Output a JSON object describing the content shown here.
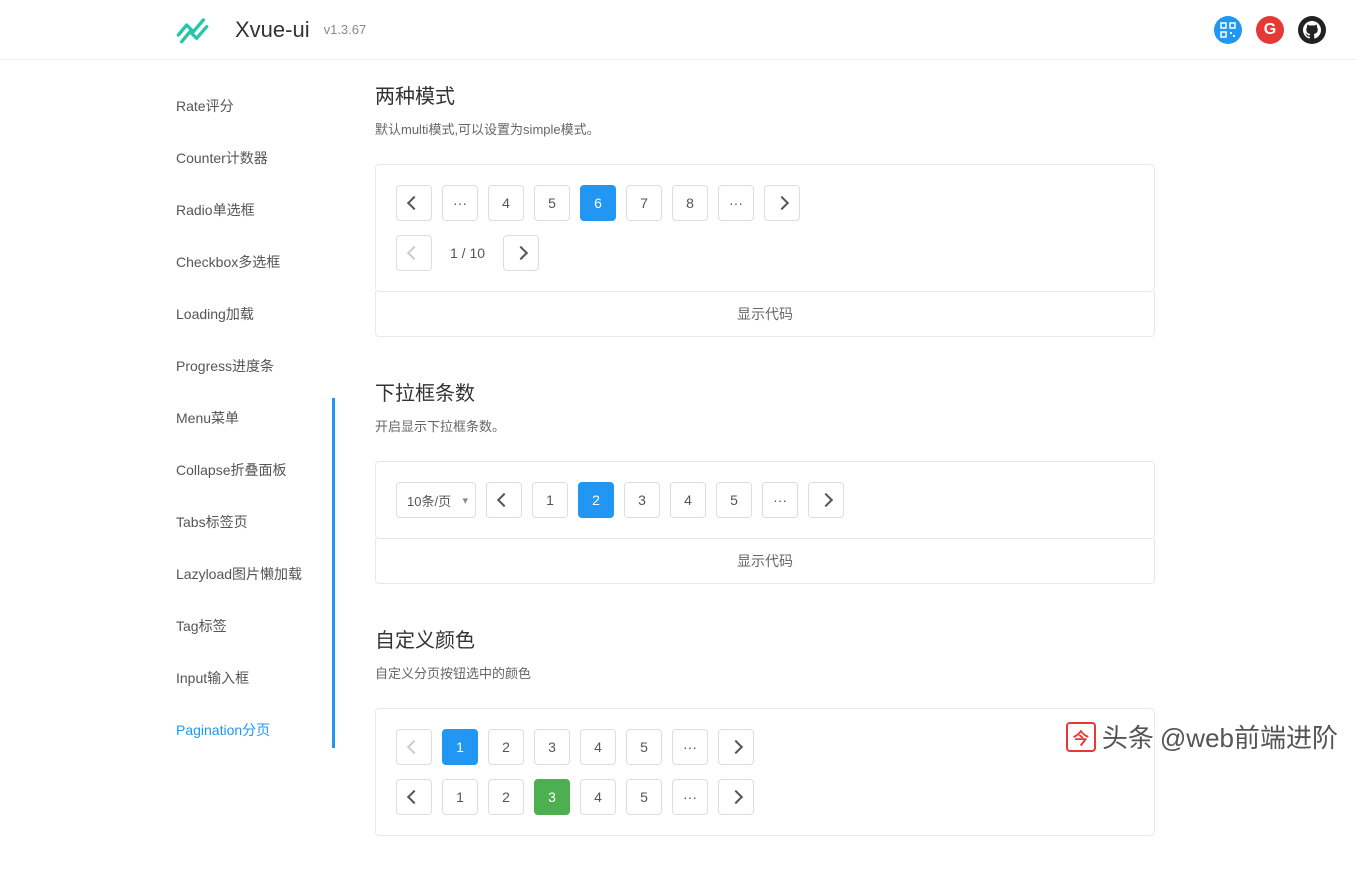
{
  "header": {
    "title": "Xvue-ui",
    "version": "v1.3.67"
  },
  "sidebar": {
    "items": [
      {
        "label": "Rate评分",
        "active": false
      },
      {
        "label": "Counter计数器",
        "active": false
      },
      {
        "label": "Radio单选框",
        "active": false
      },
      {
        "label": "Checkbox多选框",
        "active": false
      },
      {
        "label": "Loading加载",
        "active": false
      },
      {
        "label": "Progress进度条",
        "active": false
      },
      {
        "label": "Menu菜单",
        "active": false
      },
      {
        "label": "Collapse折叠面板",
        "active": false
      },
      {
        "label": "Tabs标签页",
        "active": false
      },
      {
        "label": "Lazyload图片懒加载",
        "active": false
      },
      {
        "label": "Tag标签",
        "active": false
      },
      {
        "label": "Input输入框",
        "active": false
      },
      {
        "label": "Pagination分页",
        "active": true
      }
    ]
  },
  "sections": {
    "s1": {
      "title": "两种模式",
      "desc": "默认multi模式,可以设置为simple模式。",
      "row1": {
        "ellipsis_l": "···",
        "p4": "4",
        "p5": "5",
        "p6": "6",
        "p7": "7",
        "p8": "8",
        "ellipsis_r": "···"
      },
      "row2_info": "1 / 10",
      "show_code": "显示代码"
    },
    "s2": {
      "title": "下拉框条数",
      "desc": "开启显示下拉框条数。",
      "select": "10条/页",
      "row": {
        "p1": "1",
        "p2": "2",
        "p3": "3",
        "p4": "4",
        "p5": "5",
        "ellipsis": "···"
      },
      "show_code": "显示代码"
    },
    "s3": {
      "title": "自定义颜色",
      "desc": "自定义分页按钮选中的颜色",
      "row1": {
        "p1": "1",
        "p2": "2",
        "p3": "3",
        "p4": "4",
        "p5": "5",
        "ellipsis": "···"
      },
      "row2": {
        "p1": "1",
        "p2": "2",
        "p3": "3",
        "p4": "4",
        "p5": "5",
        "ellipsis": "···"
      }
    }
  },
  "watermark": {
    "prefix": "头条",
    "text": "@web前端进阶"
  }
}
